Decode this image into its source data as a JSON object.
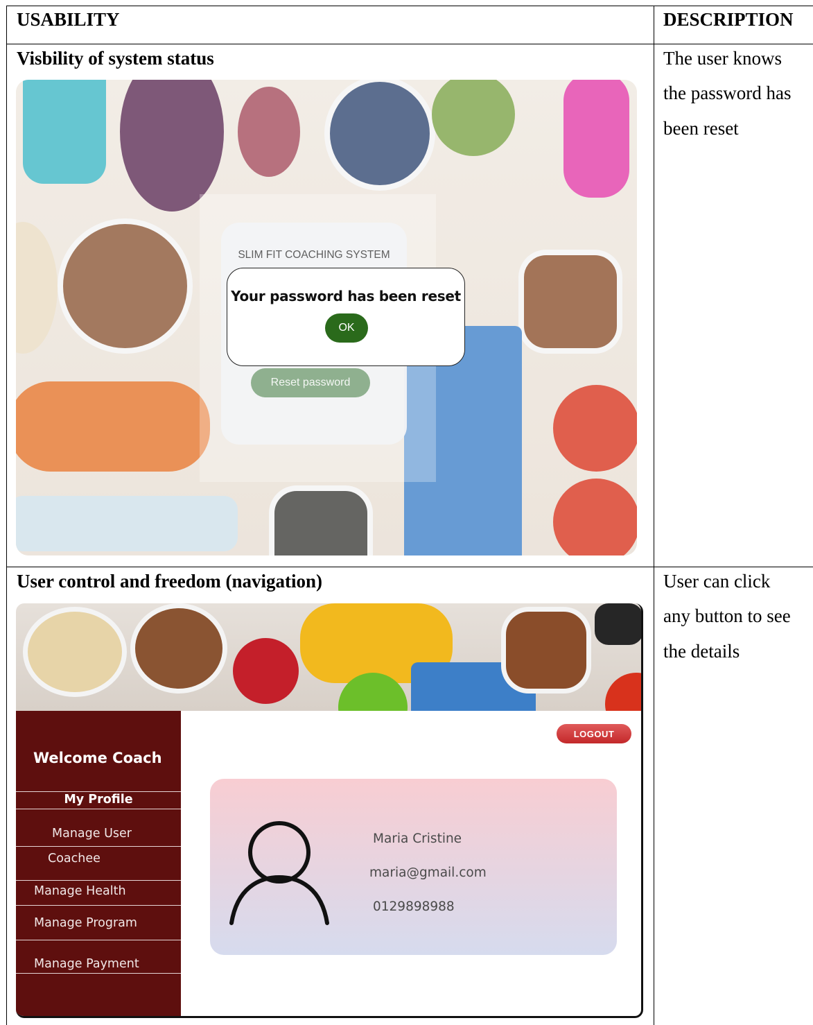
{
  "table": {
    "headers": {
      "usability": "USABILITY",
      "description": "DESCRIPTION"
    },
    "rows": [
      {
        "heading": "Visbility of system status",
        "description_lines": [
          "The user knows",
          "the password has",
          "been reset"
        ]
      },
      {
        "heading": "User control and freedom (navigation)",
        "description_lines": [
          "User can click",
          "any button to see",
          "the details"
        ]
      }
    ]
  },
  "reset_screen": {
    "system_title": "SLIM FIT COACHING SYSTEM",
    "dialog_message": "Your password has been reset",
    "ok_label": "OK",
    "reset_button_label": "Reset password",
    "colors": {
      "ok_button": "#2a6a1b",
      "reset_button": "#8fb08f"
    }
  },
  "dashboard": {
    "welcome": "Welcome Coach",
    "logout_label": "LOGOUT",
    "nav": {
      "my_profile": "My Profile",
      "manage_user": "Manage User",
      "coachee": "Coachee",
      "manage_health": "Manage Health",
      "manage_program": "Manage Program",
      "manage_payment": "Manage Payment"
    },
    "profile": {
      "name": "Maria Cristine",
      "email": "maria@gmail.com",
      "phone": "0129898988"
    },
    "colors": {
      "sidebar": "#5e0f0e",
      "logout": "#c3282a"
    }
  }
}
